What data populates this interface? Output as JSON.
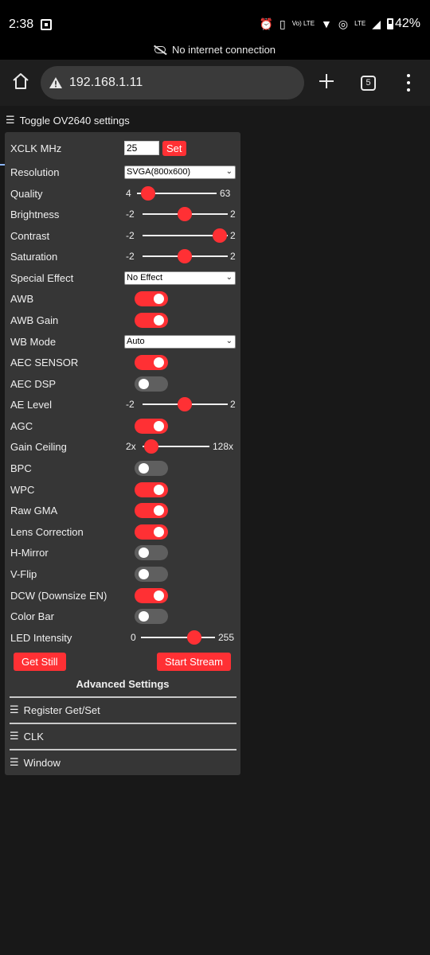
{
  "status_bar": {
    "time": "2:38",
    "network_label": "LTE",
    "volte_label": "Vo) LTE",
    "battery": "42%"
  },
  "banner": {
    "text": "No internet connection"
  },
  "browser": {
    "url": "192.168.1.11",
    "tab_count": "5"
  },
  "page": {
    "toggle_label": "Toggle OV2640 settings",
    "settings": {
      "xclk": {
        "label": "XCLK MHz",
        "value": "25",
        "button": "Set"
      },
      "resolution": {
        "label": "Resolution",
        "selected": "SVGA(800x600)"
      },
      "quality": {
        "label": "Quality",
        "min": "4",
        "max": "63",
        "value": 10
      },
      "brightness": {
        "label": "Brightness",
        "min": "-2",
        "max": "2",
        "value": 0
      },
      "contrast": {
        "label": "Contrast",
        "min": "-2",
        "max": "2",
        "value": 2
      },
      "saturation": {
        "label": "Saturation",
        "min": "-2",
        "max": "2",
        "value": 0
      },
      "special_effect": {
        "label": "Special Effect",
        "selected": "No Effect"
      },
      "awb": {
        "label": "AWB",
        "on": true
      },
      "awb_gain": {
        "label": "AWB Gain",
        "on": true
      },
      "wb_mode": {
        "label": "WB Mode",
        "selected": "Auto"
      },
      "aec_sensor": {
        "label": "AEC SENSOR",
        "on": true
      },
      "aec_dsp": {
        "label": "AEC DSP",
        "on": false
      },
      "ae_level": {
        "label": "AE Level",
        "min": "-2",
        "max": "2",
        "value": 0
      },
      "agc": {
        "label": "AGC",
        "on": true
      },
      "gain_ceiling": {
        "label": "Gain Ceiling",
        "min": "2x",
        "max": "128x",
        "value": 0
      },
      "bpc": {
        "label": "BPC",
        "on": false
      },
      "wpc": {
        "label": "WPC",
        "on": true
      },
      "raw_gma": {
        "label": "Raw GMA",
        "on": true
      },
      "lens_correction": {
        "label": "Lens Correction",
        "on": true
      },
      "h_mirror": {
        "label": "H-Mirror",
        "on": false
      },
      "v_flip": {
        "label": "V-Flip",
        "on": false
      },
      "dcw": {
        "label": "DCW (Downsize EN)",
        "on": true
      },
      "color_bar": {
        "label": "Color Bar",
        "on": false
      },
      "led_intensity": {
        "label": "LED Intensity",
        "min": "0",
        "max": "255",
        "value": 170
      }
    },
    "buttons": {
      "get_still": "Get Still",
      "start_stream": "Start Stream"
    },
    "advanced": {
      "title": "Advanced Settings",
      "items": [
        "Register Get/Set",
        "CLK",
        "Window"
      ]
    }
  },
  "colors": {
    "accent": "#ff3034",
    "panel": "#363636",
    "background": "#181818"
  }
}
